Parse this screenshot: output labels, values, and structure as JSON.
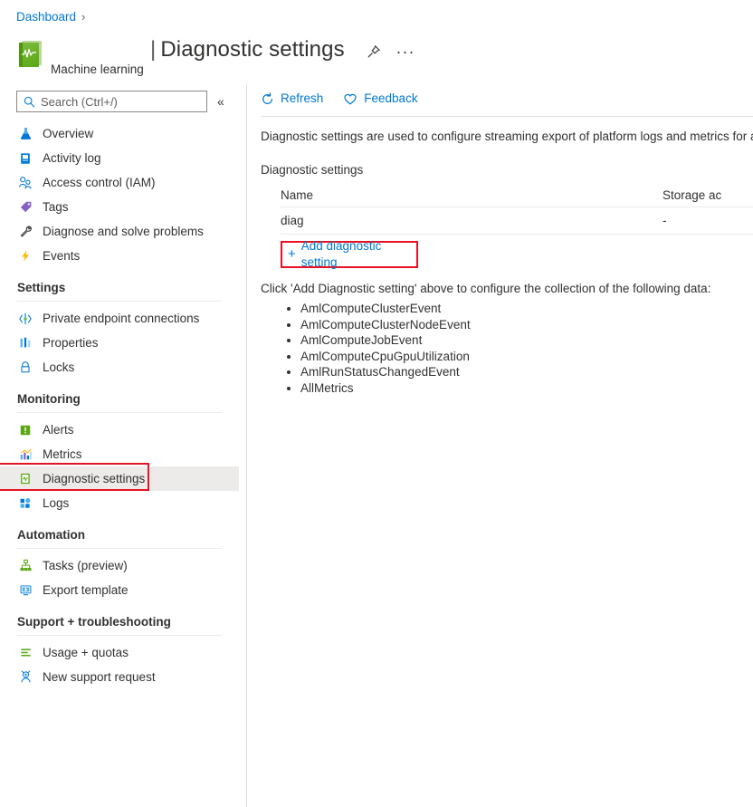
{
  "breadcrumb": {
    "root": "Dashboard",
    "separator": "›"
  },
  "resource": {
    "name": "Machine learning",
    "icon": "machine-learning-icon"
  },
  "header": {
    "title_bar": "|",
    "title": "Diagnostic settings",
    "pin_icon": "pin-icon",
    "more_icon": "···"
  },
  "search": {
    "placeholder": "Search (Ctrl+/)",
    "value": "",
    "icon": "search-icon",
    "collapse_icon": "«"
  },
  "commandbar": {
    "refresh_label": "Refresh",
    "refresh_icon": "refresh-icon",
    "feedback_label": "Feedback",
    "feedback_icon": "heart-icon"
  },
  "main": {
    "description": "Diagnostic settings are used to configure streaming export of platform logs and metrics for a re",
    "section_label": "Diagnostic settings",
    "table": {
      "columns": [
        "Name",
        "Storage ac"
      ],
      "rows": [
        {
          "name": "diag",
          "storage": "-"
        }
      ]
    },
    "add_button": {
      "plus": "+",
      "label": "Add diagnostic setting"
    },
    "hint": "Click 'Add Diagnostic setting' above to configure the collection of the following data:",
    "data_items": [
      "AmlComputeClusterEvent",
      "AmlComputeClusterNodeEvent",
      "AmlComputeJobEvent",
      "AmlComputeCpuGpuUtilization",
      "AmlRunStatusChangedEvent",
      "AllMetrics"
    ]
  },
  "sidebar": {
    "top_items": [
      {
        "label": "Overview",
        "icon": "overview-icon"
      },
      {
        "label": "Activity log",
        "icon": "activity-log-icon"
      },
      {
        "label": "Access control (IAM)",
        "icon": "access-control-icon"
      },
      {
        "label": "Tags",
        "icon": "tags-icon"
      },
      {
        "label": "Diagnose and solve problems",
        "icon": "wrench-icon"
      },
      {
        "label": "Events",
        "icon": "lightning-icon"
      }
    ],
    "sections": [
      {
        "title": "Settings",
        "items": [
          {
            "label": "Private endpoint connections",
            "icon": "private-endpoint-icon"
          },
          {
            "label": "Properties",
            "icon": "properties-icon"
          },
          {
            "label": "Locks",
            "icon": "lock-icon"
          }
        ]
      },
      {
        "title": "Monitoring",
        "items": [
          {
            "label": "Alerts",
            "icon": "alerts-icon"
          },
          {
            "label": "Metrics",
            "icon": "metrics-icon"
          },
          {
            "label": "Diagnostic settings",
            "icon": "diagnostic-settings-icon",
            "selected": true
          },
          {
            "label": "Logs",
            "icon": "logs-icon"
          }
        ]
      },
      {
        "title": "Automation",
        "items": [
          {
            "label": "Tasks (preview)",
            "icon": "tasks-icon"
          },
          {
            "label": "Export template",
            "icon": "export-template-icon"
          }
        ]
      },
      {
        "title": "Support + troubleshooting",
        "items": [
          {
            "label": "Usage + quotas",
            "icon": "usage-quotas-icon"
          },
          {
            "label": "New support request",
            "icon": "support-request-icon"
          }
        ]
      }
    ]
  },
  "colors": {
    "accent": "#0078d4",
    "highlight": "#e81123",
    "selected_bg": "#edebe9",
    "text": "#323130"
  }
}
